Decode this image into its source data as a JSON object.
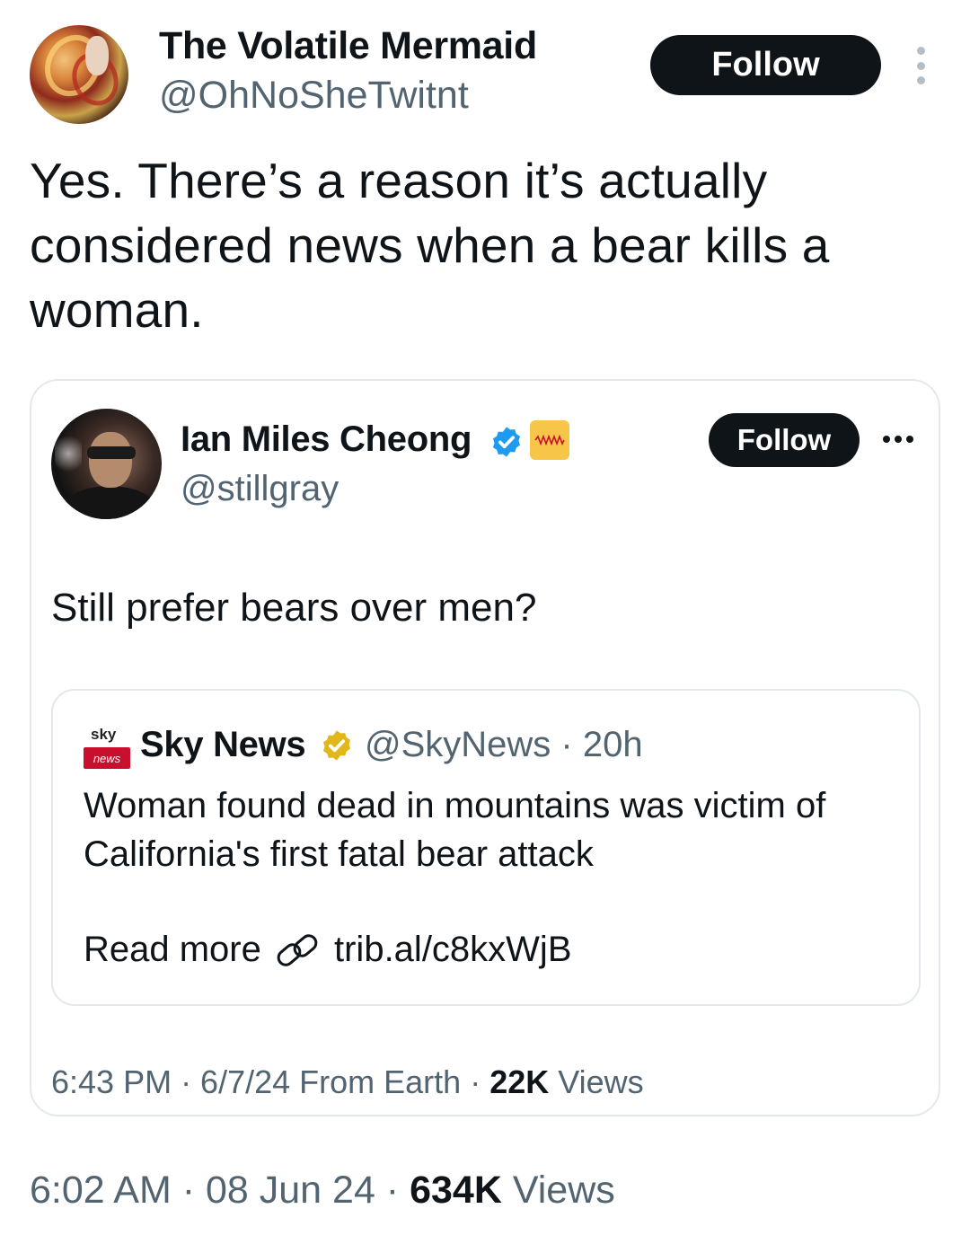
{
  "author": {
    "display_name": "The Volatile Mermaid",
    "handle": "@OhNoSheTwitnt",
    "follow_label": "Follow"
  },
  "tweet": {
    "text": "Yes. There’s a reason it’s actually considered news when a bear kills a woman."
  },
  "quoted": {
    "display_name": "Ian Miles Cheong",
    "handle": "@stillgray",
    "follow_label": "Follow",
    "text": "Still prefer bears over men?",
    "meta_time": "6:43 PM · 6/7/24 From Earth · ",
    "meta_views_count": "22K",
    "meta_views_label": " Views",
    "inner": {
      "logo_top": "sky",
      "logo_bar": "news",
      "display_name": "Sky News",
      "handle_time": "@SkyNews · 20h",
      "text": "Woman found dead in mountains was victim of California's first fatal bear attack",
      "read_more": "Read more",
      "link": "trib.al/c8kxWjB"
    }
  },
  "footer": {
    "time": "6:02 AM · 08 Jun 24 · ",
    "views_count": "634K",
    "views_label": " Views"
  },
  "colors": {
    "text": "#0f1419",
    "secondary": "#536471",
    "verified_blue": "#1d9bf0",
    "verified_gold": "#e2b719",
    "sky_red": "#c8102e"
  }
}
